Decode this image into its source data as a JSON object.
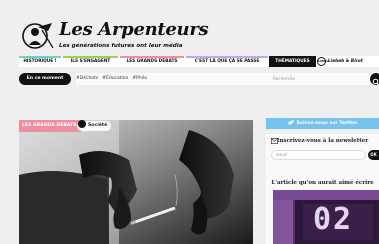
{
  "brand": {
    "title": "Les Arpenteurs",
    "tagline": "Les générations futures ont leur média"
  },
  "nav": {
    "items": [
      {
        "label": "HISTORIQUE !",
        "color": "#6ad3c4"
      },
      {
        "label": "ILS S'ENGAGENT",
        "color": "#9bd14c"
      },
      {
        "label": "LES GRANDS DÉBATS",
        "color": "#f08ca3"
      },
      {
        "label": "C'EST LÀ QUE ÇA SE PASSE",
        "color": "#c4a7ea"
      },
      {
        "label": "THÉMATIQUES",
        "color": "#111111"
      }
    ],
    "partner": {
      "logo_text": "CAMBIA",
      "name": "Liebeb & Birot"
    }
  },
  "subbar": {
    "moment_label": "En ce moment",
    "tags": [
      "#Déchets",
      "#Éducation",
      "#Philo"
    ],
    "search_placeholder": "Recherche"
  },
  "article": {
    "category": "LES GRANDS DÉBATS",
    "rubric": "Société"
  },
  "sidebar": {
    "twitter_label": "Suivez-nous sur Twitter",
    "newsletter_title": "Inscrivez-vous à la newsletter",
    "email_placeholder": "email",
    "ok_label": "OK",
    "recommended_title": "L'article qu'on aurait aimé écrire",
    "clock_text": "02"
  },
  "colors": {
    "accent_pink": "#f08ca3",
    "twitter_blue": "#76c3ef",
    "dark": "#111111"
  }
}
